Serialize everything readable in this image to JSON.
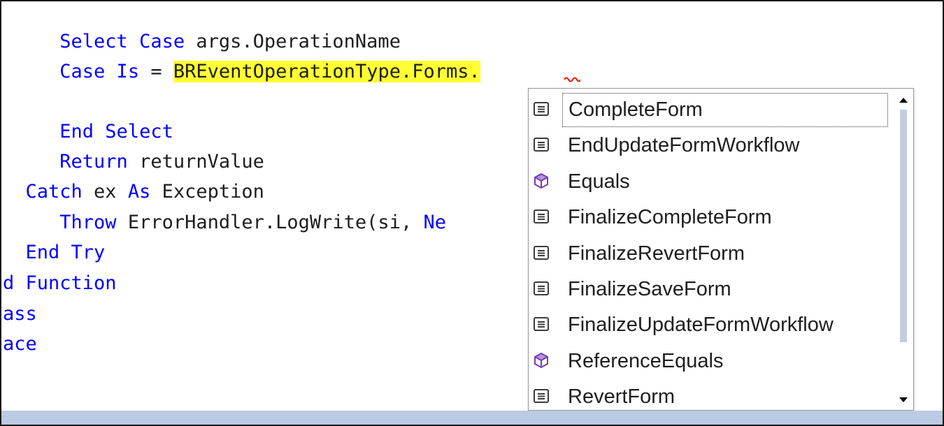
{
  "code_lines": [
    {
      "id": "line-1",
      "indent": "     ",
      "tokens": [
        {
          "t": "Select Case",
          "k": "kw"
        },
        {
          "t": " args.OperationName",
          "k": "plain"
        }
      ]
    },
    {
      "id": "line-2",
      "indent": "     ",
      "tokens": [
        {
          "t": "Case Is",
          "k": "kw"
        },
        {
          "t": " = ",
          "k": "plain"
        },
        {
          "t": "BREventOperationType.Forms.",
          "k": "hl"
        }
      ]
    },
    {
      "id": "line-3",
      "indent": "",
      "tokens": []
    },
    {
      "id": "line-4",
      "indent": "     ",
      "tokens": [
        {
          "t": "End Select",
          "k": "kw"
        }
      ]
    },
    {
      "id": "line-5",
      "indent": "     ",
      "tokens": [
        {
          "t": "Return",
          "k": "kw"
        },
        {
          "t": " returnValue",
          "k": "plain"
        }
      ]
    },
    {
      "id": "line-6",
      "indent": "  ",
      "tokens": [
        {
          "t": "Catch",
          "k": "kw"
        },
        {
          "t": " ex ",
          "k": "plain"
        },
        {
          "t": "As",
          "k": "kw"
        },
        {
          "t": " Exception",
          "k": "plain"
        }
      ]
    },
    {
      "id": "line-7",
      "indent": "     ",
      "tokens": [
        {
          "t": "Throw",
          "k": "kw"
        },
        {
          "t": " ErrorHandler.LogWrite(si, ",
          "k": "plain"
        },
        {
          "t": "Ne",
          "k": "kw"
        }
      ]
    },
    {
      "id": "line-8",
      "indent": "  ",
      "tokens": [
        {
          "t": "End Try",
          "k": "kw"
        }
      ]
    },
    {
      "id": "line-9",
      "indent": "",
      "tokens": [
        {
          "t": "d Function",
          "k": "kw"
        }
      ]
    },
    {
      "id": "line-10",
      "indent": "",
      "tokens": [
        {
          "t": "ass",
          "k": "kw"
        }
      ]
    },
    {
      "id": "line-11",
      "indent": "",
      "tokens": [
        {
          "t": "ace",
          "k": "kw"
        }
      ]
    }
  ],
  "completion_list": {
    "items": [
      {
        "label": "CompleteForm",
        "kind": "field",
        "icon": "enum-member-icon",
        "selected": true
      },
      {
        "label": "EndUpdateFormWorkflow",
        "kind": "field",
        "icon": "enum-member-icon",
        "selected": false
      },
      {
        "label": "Equals",
        "kind": "method",
        "icon": "method-cube-icon",
        "selected": false
      },
      {
        "label": "FinalizeCompleteForm",
        "kind": "field",
        "icon": "enum-member-icon",
        "selected": false
      },
      {
        "label": "FinalizeRevertForm",
        "kind": "field",
        "icon": "enum-member-icon",
        "selected": false
      },
      {
        "label": "FinalizeSaveForm",
        "kind": "field",
        "icon": "enum-member-icon",
        "selected": false
      },
      {
        "label": "FinalizeUpdateFormWorkflow",
        "kind": "field",
        "icon": "enum-member-icon",
        "selected": false
      },
      {
        "label": "ReferenceEquals",
        "kind": "method",
        "icon": "method-cube-icon",
        "selected": false
      },
      {
        "label": "RevertForm",
        "kind": "field",
        "icon": "enum-member-icon",
        "selected": false
      }
    ],
    "scroll_position": 0
  },
  "colors": {
    "keyword": "#0000ff",
    "text": "#1e1e1e",
    "highlight": "#ffff33",
    "squiggle": "#e51400",
    "method_icon": "#7a3bb5",
    "field_icon": "#3c3c3c",
    "scrollbar_thumb": "#c2cde0",
    "bottom_bar": "#bccbe3"
  }
}
